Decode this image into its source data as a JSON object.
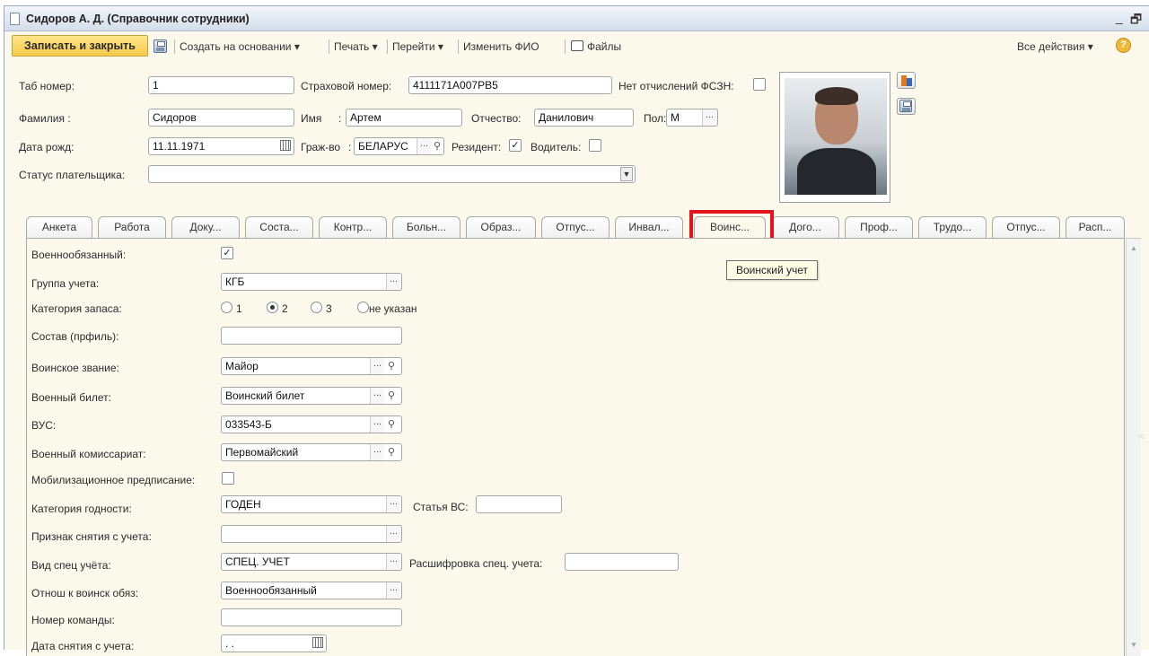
{
  "window": {
    "title": "Сидоров А. Д. (Справочник сотрудники)",
    "minimize": "_",
    "restore": "🗗"
  },
  "toolbar": {
    "save_close": "Записать и закрыть",
    "create_based": "Создать на основании ▾",
    "print": "Печать ▾",
    "goto": "Перейти ▾",
    "change_fio": "Изменить ФИО",
    "files": "Файлы",
    "all_actions": "Все действия ▾",
    "help": "?"
  },
  "header": {
    "tab_num_label": "Таб номер:",
    "tab_num": "1",
    "insurance_label": "Страховой номер:",
    "insurance": "4111171A007PB5",
    "no_fszn_label": "Нет отчислений ФСЗН:",
    "surname_label": "Фамилия :",
    "surname": "Сидоров",
    "name_label": "Имя",
    "name_colon": ":",
    "name": "Артем",
    "patronymic_label": "Отчество:",
    "patronymic": "Данилович",
    "sex_label": "Пол:",
    "sex": "М",
    "birth_label": "Дата рожд:",
    "birth": "11.11.1971",
    "citizenship_label": "Граж-во",
    "citizenship_colon": ":",
    "citizenship": "БЕЛАРУС",
    "resident_label": "Резидент:",
    "driver_label": "Водитель:",
    "payer_status_label": "Статус плательщика:",
    "payer_status": ""
  },
  "tabs": [
    {
      "label": "Анкета"
    },
    {
      "label": "Работа"
    },
    {
      "label": "Доку..."
    },
    {
      "label": "Соста..."
    },
    {
      "label": "Контр..."
    },
    {
      "label": "Больн..."
    },
    {
      "label": "Образ..."
    },
    {
      "label": "Отпус..."
    },
    {
      "label": "Инвал..."
    },
    {
      "label": "Воинс..."
    },
    {
      "label": "Дого..."
    },
    {
      "label": "Проф..."
    },
    {
      "label": "Трудо..."
    },
    {
      "label": "Отпус..."
    },
    {
      "label": "Расп..."
    }
  ],
  "tooltip": "Воинский учет",
  "military": {
    "liable_label": "Военнообязанный:",
    "group_label": "Группа учета:",
    "group": "КГБ",
    "reserve_label": "Категория запаса:",
    "reserve_options": [
      "1",
      "2",
      "3",
      "не указан"
    ],
    "composition_label": "Состав (прфиль):",
    "composition": "",
    "rank_label": "Воинское звание:",
    "rank": "Майор",
    "ticket_label": "Военный билет:",
    "ticket": "Воинский билет",
    "vus_label": "ВУС:",
    "vus": "033543-Б",
    "commissariat_label": "Военный комиссариат:",
    "commissariat": "Первомайский",
    "mobilization_label": "Мобилизационное предписание:",
    "fitness_label": "Категория годности:",
    "fitness": "ГОДЕН",
    "article_label": "Статья ВС:",
    "article": "",
    "removal_sign_label": "Признак снятия с учета:",
    "removal_sign": "",
    "special_label": "Вид спец учёта:",
    "special": "СПЕЦ. УЧЕТ",
    "special_decode_label": "Расшифровка спец. учета:",
    "special_decode": "",
    "attitude_label": "Отнош к воинск обяз:",
    "attitude": "Военнообязанный",
    "team_label": "Номер команды:",
    "team": "",
    "removal_date_label": "Дата снятия с учета:",
    "removal_date": ". ."
  },
  "colors": {
    "highlight": "#e3141b",
    "primary_button": "#f6c94a",
    "form_bg": "#fbf9ec"
  }
}
